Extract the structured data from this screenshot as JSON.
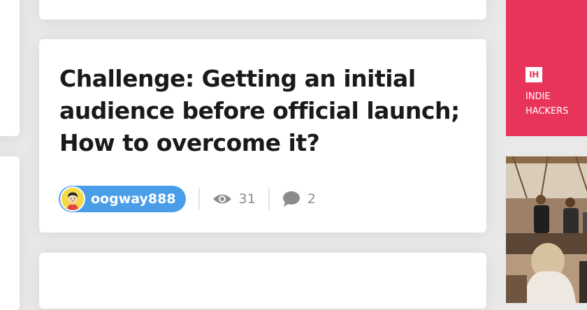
{
  "post": {
    "title": "Challenge: Getting an initial audience before official launch; How to overcome it?",
    "author": "oogway888",
    "views": "31",
    "comments": "2"
  },
  "sidebar_ad": {
    "logo_text": "IH",
    "brand_text": "INDIE\nHACKERS",
    "color": "#e8345a"
  },
  "icons": {
    "views": "eye-icon",
    "comments": "speech-bubble-icon"
  },
  "colors": {
    "author_pill": "#4a9ee8",
    "avatar_bg": "#f6d94a",
    "meta_gray": "#8c8c8c"
  }
}
